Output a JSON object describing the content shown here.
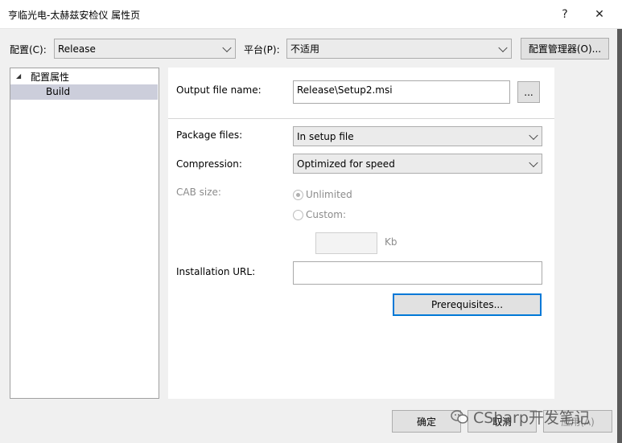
{
  "window": {
    "title": "亨临光电-太赫兹安检仪 属性页",
    "help_label": "?",
    "close_label": "✕"
  },
  "toolbar": {
    "config_label": "配置(C):",
    "config_value": "Release",
    "platform_label": "平台(P):",
    "platform_value": "不适用",
    "config_manager_label": "配置管理器(O)..."
  },
  "tree": {
    "root_label": "配置属性",
    "root_expander": "◢",
    "child_label": "Build"
  },
  "form": {
    "output_label": "Output file name:",
    "output_value": "Release\\Setup2.msi",
    "browse_label": "...",
    "package_label": "Package files:",
    "package_value": "In setup file",
    "compression_label": "Compression:",
    "compression_value": "Optimized for speed",
    "cab_label": "CAB size:",
    "unlimited_label": "Unlimited",
    "custom_label": "Custom:",
    "kb_label": "Kb",
    "install_url_label": "Installation URL:",
    "install_url_value": "",
    "prereq_label": "Prerequisites..."
  },
  "footer": {
    "ok_label": "确定",
    "cancel_label": "取消",
    "apply_label": "应用(A)"
  },
  "watermark": {
    "text": "CSharp开发笔记"
  }
}
